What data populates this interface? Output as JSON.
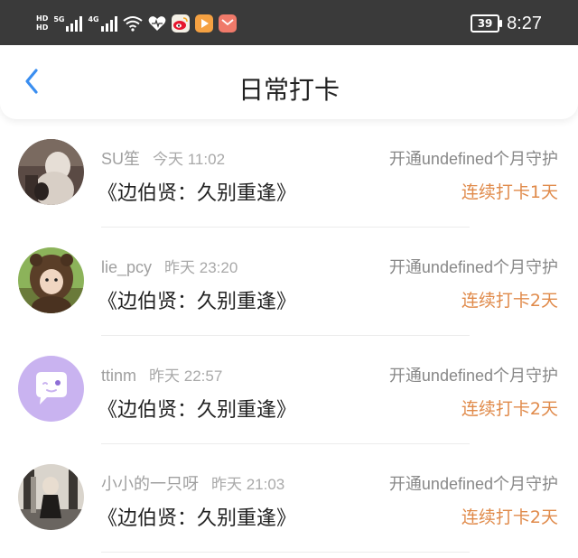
{
  "status_bar": {
    "hd1": "HD",
    "hd2": "HD",
    "net1": "5G",
    "net2": "4G",
    "battery": "39",
    "time": "8:27",
    "icons": [
      "wifi-icon",
      "health-heart-icon",
      "weibo-icon",
      "video-app-icon",
      "mail-app-icon"
    ]
  },
  "nav": {
    "title": "日常打卡",
    "back_icon": "chevron-left-icon"
  },
  "colors": {
    "accent": "#3a8ef0",
    "streak": "#e08a4a",
    "status_bar_bg": "#3a3a3a"
  },
  "checkins": [
    {
      "user": "SU笙",
      "time": "今天 11:02",
      "guard": "开通undefined个月守护",
      "book": "《边伯贤：久别重逢》",
      "streak": "连续打卡1天"
    },
    {
      "user": "lie_pcy",
      "time": "昨天 23:20",
      "guard": "开通undefined个月守护",
      "book": "《边伯贤：久别重逢》",
      "streak": "连续打卡2天"
    },
    {
      "user": "ttinm",
      "time": "昨天 22:57",
      "guard": "开通undefined个月守护",
      "book": "《边伯贤：久别重逢》",
      "streak": "连续打卡2天"
    },
    {
      "user": "小小的一只呀",
      "time": "昨天 21:03",
      "guard": "开通undefined个月守护",
      "book": "《边伯贤：久别重逢》",
      "streak": "连续打卡2天"
    }
  ]
}
